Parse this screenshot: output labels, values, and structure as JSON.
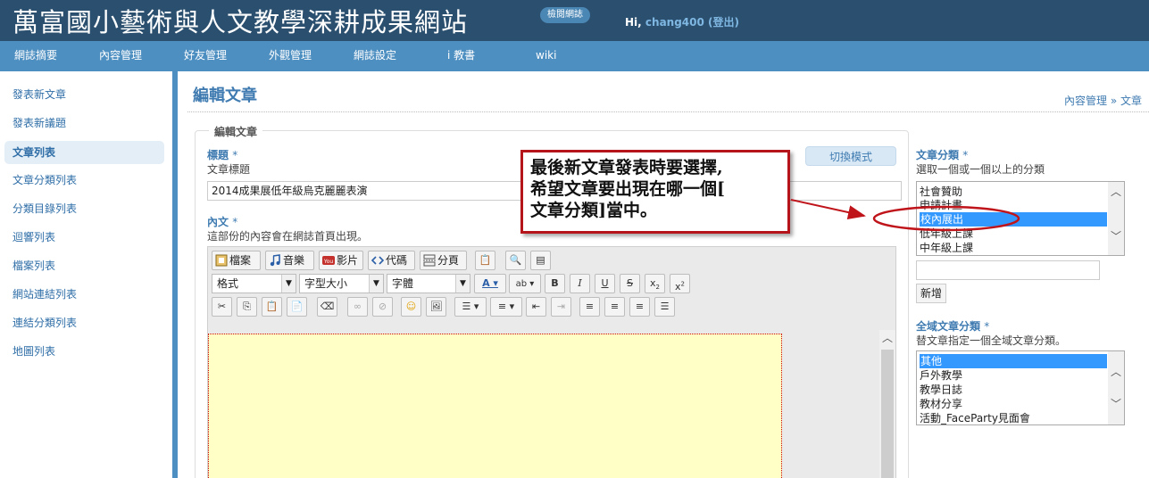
{
  "header": {
    "site_title": "萬富國小藝術與人文教學深耕成果網站",
    "browse_badge": "檢閱網誌",
    "greeting_prefix": "Hi, ",
    "username": "chang400",
    "logout_label": "(登出)"
  },
  "nav": {
    "items": [
      "網誌摘要",
      "內容管理",
      "好友管理",
      "外觀管理",
      "網誌設定",
      "i 教書",
      "wiki"
    ]
  },
  "sidebar": {
    "items": [
      {
        "label": "發表新文章",
        "active": false
      },
      {
        "label": "發表新議題",
        "active": false
      },
      {
        "label": "文章列表",
        "active": true
      },
      {
        "label": "文章分類列表",
        "active": false
      },
      {
        "label": "分類目錄列表",
        "active": false
      },
      {
        "label": "迴響列表",
        "active": false
      },
      {
        "label": "檔案列表",
        "active": false
      },
      {
        "label": "網站連結列表",
        "active": false
      },
      {
        "label": "連結分類列表",
        "active": false
      },
      {
        "label": "地圖列表",
        "active": false
      }
    ]
  },
  "main": {
    "page_title": "編輯文章",
    "breadcrumb": "內容管理 » 文章",
    "legend": "編輯文章",
    "switch_mode_label": "切換模式",
    "title_field": {
      "label": "標題",
      "required_mark": "*",
      "hint": "文章標題",
      "value": "2014成果展低年級烏克麗麗表演"
    },
    "content_field": {
      "label": "內文",
      "required_mark": "*",
      "hint": "這部份的內容會在網誌首頁出現。"
    },
    "toolbar": {
      "row1": [
        "檔案",
        "音樂",
        "影片",
        "代碼",
        "分頁"
      ],
      "format_combo": "格式",
      "size_combo": "字型大小",
      "font_combo": "字體"
    }
  },
  "right": {
    "category": {
      "label": "文章分類",
      "required_mark": "*",
      "hint": "選取一個或一個以上的分類",
      "options": [
        "社會贊助",
        "申請計畫",
        "校內展出",
        "低年級上課",
        "中年級上課"
      ],
      "selected": "校內展出",
      "add_label": "新增"
    },
    "global_category": {
      "label": "全域文章分類",
      "required_mark": "*",
      "hint": "替文章指定一個全域文章分類。",
      "options": [
        "其他",
        "戶外教學",
        "教學日誌",
        "教材分享",
        "活動_FaceParty見面會"
      ],
      "selected": "其他"
    }
  },
  "callout": {
    "lines": [
      "最後新文章發表時要選擇,",
      "希望文章要出現在哪一個[",
      "文章分類]當中。"
    ]
  },
  "colors": {
    "header_bg": "#2b4f6e",
    "nav_bg": "#4e8fc1",
    "link": "#2f6ea7",
    "annotation_red": "#b5141b",
    "editor_bg": "#ffffc6"
  }
}
